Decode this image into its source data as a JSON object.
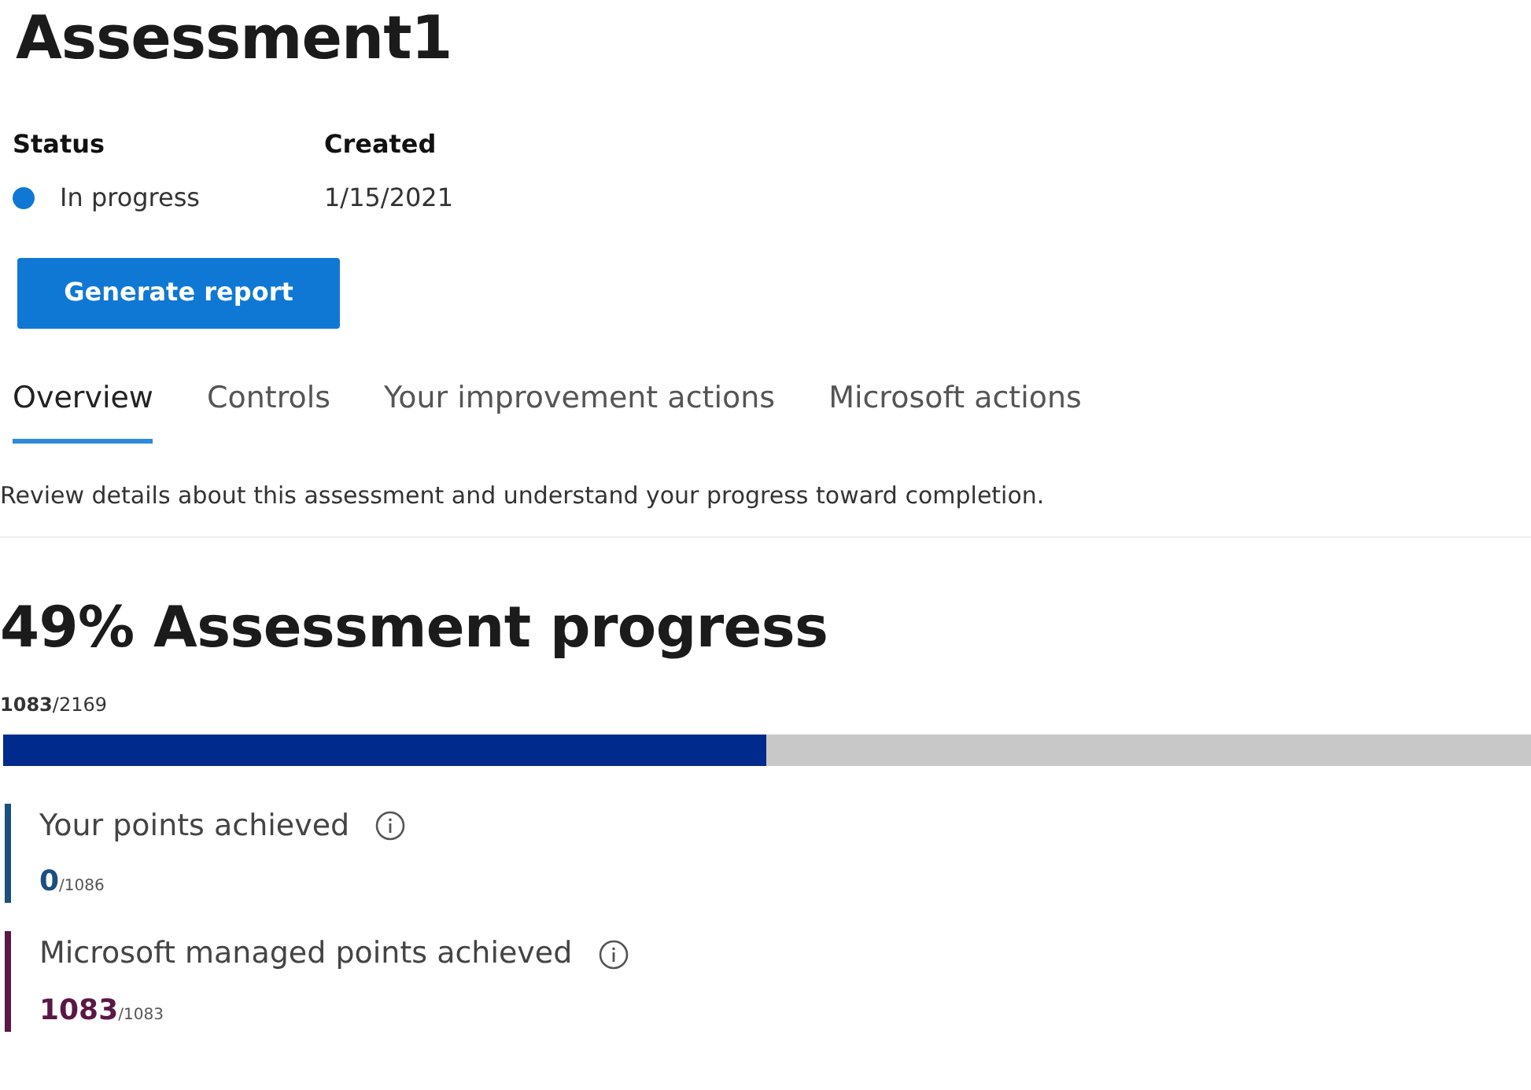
{
  "title": "Assessment1",
  "details": [
    {
      "label": "Status",
      "value": "In progress",
      "color": "#0f78d4"
    },
    {
      "label": "Created",
      "value": "1/15/2021"
    }
  ],
  "primary_button": "Generate report",
  "tabs": [
    {
      "label": "Overview",
      "selected": true
    },
    {
      "label": "Controls",
      "selected": false
    },
    {
      "label": "Your improvement actions",
      "selected": false
    },
    {
      "label": "Microsoft actions",
      "selected": false
    }
  ],
  "description": "Review details about this assessment and understand your progress toward completion.",
  "progress": {
    "heading": "49% Assessment progress",
    "reading": "**1083**/2169",
    "level": 0.4993
  },
  "points": [
    {
      "label": "Your points achieved",
      "value": "0",
      "total": "/1086",
      "color": "#1b4f7f"
    },
    {
      "label": "Microsoft managed points achieved",
      "value": "1083",
      "total": "/1083",
      "color": "#5a1846"
    }
  ]
}
